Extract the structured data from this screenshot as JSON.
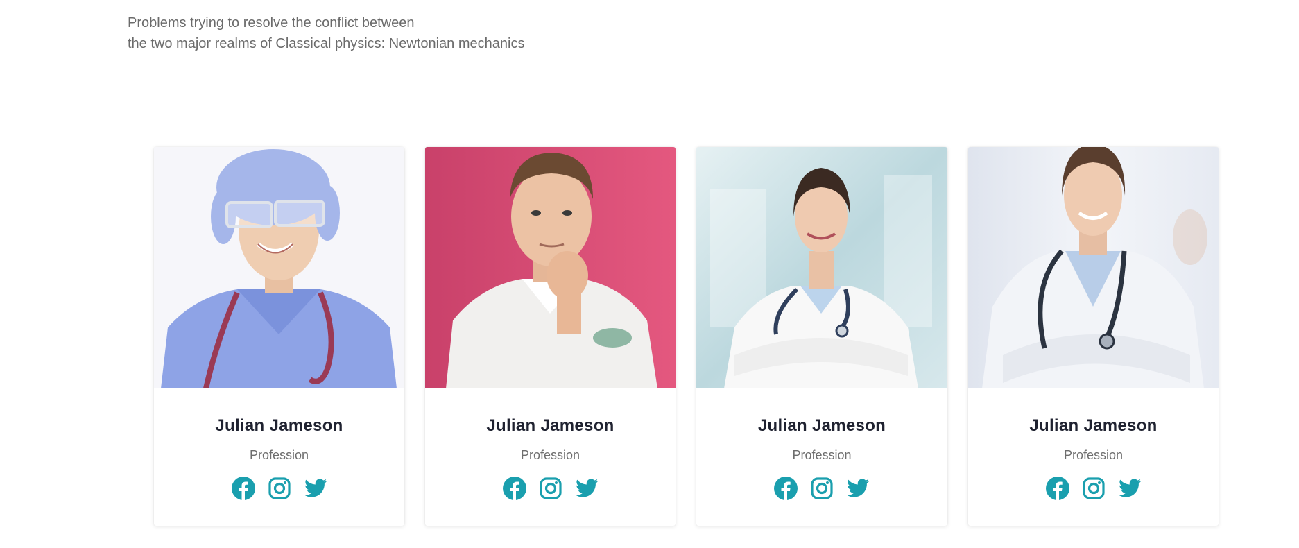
{
  "intro": {
    "line1": "Problems trying to resolve the conflict between",
    "line2": "the two major realms of Classical physics: Newtonian mechanics"
  },
  "accent_color": "#1a9fae",
  "members": [
    {
      "name": "Julian Jameson",
      "profession": "Profession",
      "photo": "female-surgeon-photo",
      "background": "#f4f5fb"
    },
    {
      "name": "Julian Jameson",
      "profession": "Profession",
      "photo": "male-doctor-photo",
      "background": "#d84a72"
    },
    {
      "name": "Julian Jameson",
      "profession": "Profession",
      "photo": "female-doctor-photo",
      "background": "#cfe3e8"
    },
    {
      "name": "Julian Jameson",
      "profession": "Profession",
      "photo": "female-doctor-photo",
      "background": "#e8ecf4"
    }
  ],
  "social_icons": [
    "facebook-icon",
    "instagram-icon",
    "twitter-icon"
  ]
}
